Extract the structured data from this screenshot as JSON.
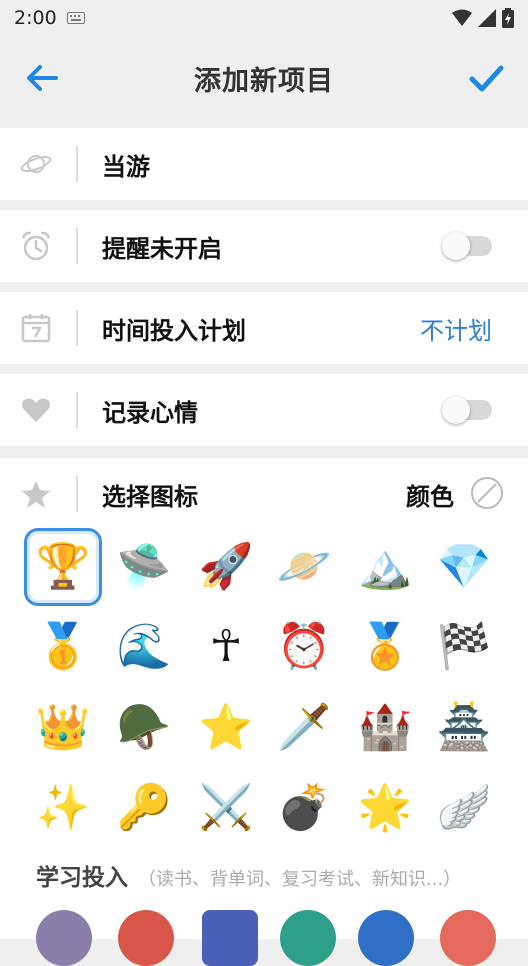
{
  "status": {
    "time": "2:00"
  },
  "header": {
    "title": "添加新项目"
  },
  "rows": {
    "name": {
      "value": "当游"
    },
    "reminder": {
      "label": "提醒未开启",
      "on": false
    },
    "plan": {
      "label": "时间投入计划",
      "value": "不计划"
    },
    "mood": {
      "label": "记录心情",
      "on": false
    }
  },
  "icon_picker": {
    "label": "选择图标",
    "color_label": "颜色",
    "selected_index": 0,
    "icons": [
      "🏆",
      "🛸",
      "🚀",
      "🪐",
      "🏔️",
      "💎",
      "🥇",
      "🌊",
      "☥",
      "⏰",
      "🏅",
      "🏁",
      "👑",
      "🪖",
      "⭐",
      "🗡️",
      "🏰",
      "🏯",
      "✨",
      "🔑",
      "⚔️",
      "💣",
      "🌟",
      "🪽"
    ]
  },
  "category": {
    "name": "学习投入",
    "hint": "（读书、背单词、复习考试、新知识...）"
  },
  "colors": {
    "accent": "#2b7fd4",
    "check": "#1e88e5",
    "selection": "#3b8ee6"
  }
}
